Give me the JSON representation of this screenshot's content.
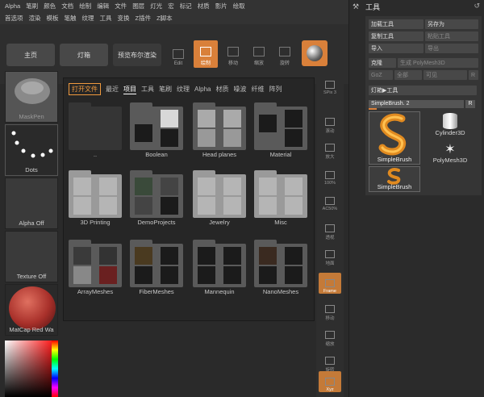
{
  "menu": {
    "row1": [
      "Alpha",
      "笔刷",
      "颜色",
      "文档",
      "绘制",
      "编辑",
      "文件",
      "图层",
      "灯光",
      "宏",
      "标记",
      "材质",
      "影片",
      "绘取"
    ],
    "row2": [
      "首选项",
      "渲染",
      "模板",
      "笔触",
      "纹理",
      "工具",
      "变换",
      "Z插件",
      "Z脚本"
    ]
  },
  "toolbar": {
    "home_label": "主页",
    "lightbox_label": "灯箱",
    "preview_label": "预览布尔渲染",
    "icons": [
      "Edit",
      "绘制",
      "移动",
      "缩放",
      "旋转"
    ]
  },
  "left_shelf": {
    "brush_label": "MaskPen",
    "stroke_label": "Dots",
    "alpha_label": "Alpha Off",
    "texture_label": "Texture Off",
    "material_label": "MatCap Red Wa"
  },
  "lightbox": {
    "tabs": [
      "打开文件",
      "最近",
      "项目",
      "工具",
      "笔刷",
      "纹理",
      "Alpha",
      "材质",
      "噪波",
      "纤维",
      "阵列"
    ],
    "folders": [
      {
        "name": ".."
      },
      {
        "name": "Boolean"
      },
      {
        "name": "Head planes"
      },
      {
        "name": "Material"
      },
      {
        "name": "3D Printing"
      },
      {
        "name": "DemoProjects"
      },
      {
        "name": "Jewelry"
      },
      {
        "name": "Misc"
      },
      {
        "name": "ArrayMeshes"
      },
      {
        "name": "FiberMeshes"
      },
      {
        "name": "Mannequin"
      },
      {
        "name": "NanoMeshes"
      }
    ]
  },
  "right_shelf": [
    "SPix 3",
    "滚动",
    "放大",
    "100%",
    "AC50%",
    "透视",
    "地面",
    "Frame",
    "移动",
    "缩放",
    "旋转",
    "Xyz"
  ],
  "tool_panel": {
    "title": "工具",
    "rows": [
      [
        "加载工具",
        "另存为"
      ],
      [
        "复制工具",
        "粘贴工具"
      ],
      [
        "导入",
        "导出"
      ],
      [
        "克隆",
        "生成 PolyMesh3D"
      ],
      [
        "GoZ",
        "全部",
        "可见",
        "R"
      ],
      [
        "灯箱▶工具"
      ]
    ],
    "slider_label": "SimpleBrush. 2",
    "r_label": "R",
    "current_tool": "SimpleBrush",
    "items": [
      {
        "name": "Cylinder3D"
      },
      {
        "name": "PolyMesh3D"
      },
      {
        "name": "SimpleBrush"
      }
    ]
  }
}
